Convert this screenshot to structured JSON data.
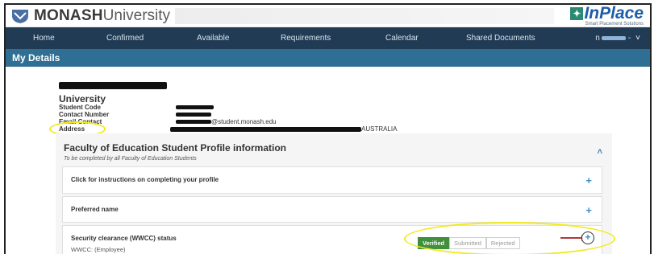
{
  "header": {
    "brand_main": "MONASH",
    "brand_sub": "University",
    "inplace_logo": "InPlace",
    "inplace_tagline": "Smart Placement Solutions"
  },
  "nav": {
    "items": [
      "Home",
      "Confirmed",
      "Available",
      "Requirements",
      "Calendar",
      "Shared Documents"
    ],
    "user_prefix": "n",
    "user_suffix": "-"
  },
  "page_title": "My Details",
  "details": {
    "heading": "University",
    "labels": [
      "Student Code",
      "Contact Number",
      "Email Contact",
      "Address"
    ],
    "email_suffix": "@student.monash.edu",
    "address_suffix": "AUSTRALIA"
  },
  "profile": {
    "title": "Faculty of Education Student Profile information",
    "subtitle": "To be completed by all Faculty of Education Students",
    "panels": [
      {
        "label": "Click for instructions on completing your profile"
      },
      {
        "label": "Preferred name"
      },
      {
        "label": "Security clearance (WWCC) status",
        "line1": "WWCC: (Employee)"
      }
    ],
    "status_options": [
      "Verified",
      "Submitted",
      "Rejected"
    ],
    "status_selected": "Verified"
  },
  "colors": {
    "nav_bg": "#213b55",
    "title_bar_bg": "#2e6f93",
    "verified_green": "#3f8f3d",
    "highlight_yellow": "#f2ea21",
    "arrow_red": "#b5363a"
  }
}
